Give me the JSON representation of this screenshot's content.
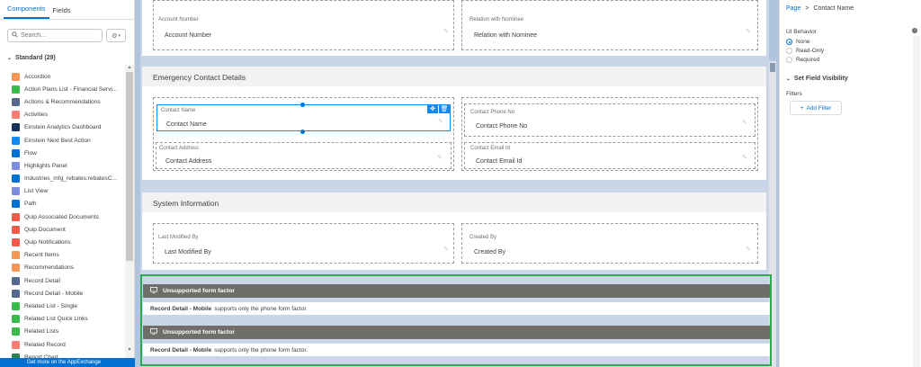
{
  "left_panel": {
    "tabs": [
      {
        "label": "Components"
      },
      {
        "label": "Fields"
      }
    ],
    "search_placeholder": "Search...",
    "section_label": "Standard (29)",
    "components": [
      {
        "label": "Accordion",
        "color": "#f49756"
      },
      {
        "label": "Action Plans List - Financial Servi...",
        "color": "#3bba4c"
      },
      {
        "label": "Actions & Recommendations",
        "color": "#54698d"
      },
      {
        "label": "Activities",
        "color": "#f77e75"
      },
      {
        "label": "Einstein Analytics Dashboard",
        "color": "#16325c"
      },
      {
        "label": "Einstein Next Best Action",
        "color": "#1589ee"
      },
      {
        "label": "Flow",
        "color": "#0070d2"
      },
      {
        "label": "Highlights Panel",
        "color": "#7f8de1"
      },
      {
        "label": "Industries_mfg_rebates:rebatesC...",
        "color": "#0070d2"
      },
      {
        "label": "List View",
        "color": "#7f8de1"
      },
      {
        "label": "Path",
        "color": "#0070d2"
      },
      {
        "label": "Quip Associated Documents",
        "color": "#f05b49"
      },
      {
        "label": "Quip Document",
        "color": "#f05b49"
      },
      {
        "label": "Quip Notifications",
        "color": "#f05b49"
      },
      {
        "label": "Recent Items",
        "color": "#f49756"
      },
      {
        "label": "Recommendations",
        "color": "#f49756"
      },
      {
        "label": "Record Detail",
        "color": "#54698d"
      },
      {
        "label": "Record Detail - Mobile",
        "color": "#54698d"
      },
      {
        "label": "Related List - Single",
        "color": "#3bba4c"
      },
      {
        "label": "Related List Quick Links",
        "color": "#3bba4c"
      },
      {
        "label": "Related Lists",
        "color": "#3bba4c"
      },
      {
        "label": "Related Record",
        "color": "#f77e75"
      },
      {
        "label": "Report Chart",
        "color": "#2e844a"
      }
    ],
    "appexchange": "Get more on the AppExchange"
  },
  "canvas": {
    "top_fields": [
      {
        "label": "Account Number",
        "value": "Account Number"
      },
      {
        "label": "Relation with Nominee",
        "value": "Relation with Nominee"
      }
    ],
    "emergency": {
      "title": "Emergency Contact Details",
      "fields": [
        {
          "label": "Contact Name",
          "value": "Contact Name"
        },
        {
          "label": "Contact Phone No",
          "value": "Contact Phone No"
        },
        {
          "label": "Contact Address",
          "value": "Contact Address"
        },
        {
          "label": "Contact Email Id",
          "value": "Contact Email Id"
        }
      ]
    },
    "system": {
      "title": "System Information",
      "fields": [
        {
          "label": "Last Modified By",
          "value": "Last Modified By"
        },
        {
          "label": "Created By",
          "value": "Created By"
        }
      ]
    },
    "unsupported": [
      {
        "title": "Unsupported form factor",
        "component": "Record Detail - Mobile",
        "message": "supports only the phone form factor."
      },
      {
        "title": "Unsupported form factor",
        "component": "Record Detail - Mobile",
        "message": "supports only the phone form factor."
      }
    ]
  },
  "right_panel": {
    "breadcrumb_root": "Page",
    "breadcrumb_sep": ">",
    "breadcrumb_current": "Contact Name",
    "ui_behavior_label": "UI Behavior",
    "options": [
      {
        "label": "None",
        "selected": true
      },
      {
        "label": "Read-Only",
        "selected": false
      },
      {
        "label": "Required",
        "selected": false
      }
    ],
    "visibility_label": "Set Field Visibility",
    "filters_label": "Filters",
    "add_filter": "Add Filter"
  }
}
